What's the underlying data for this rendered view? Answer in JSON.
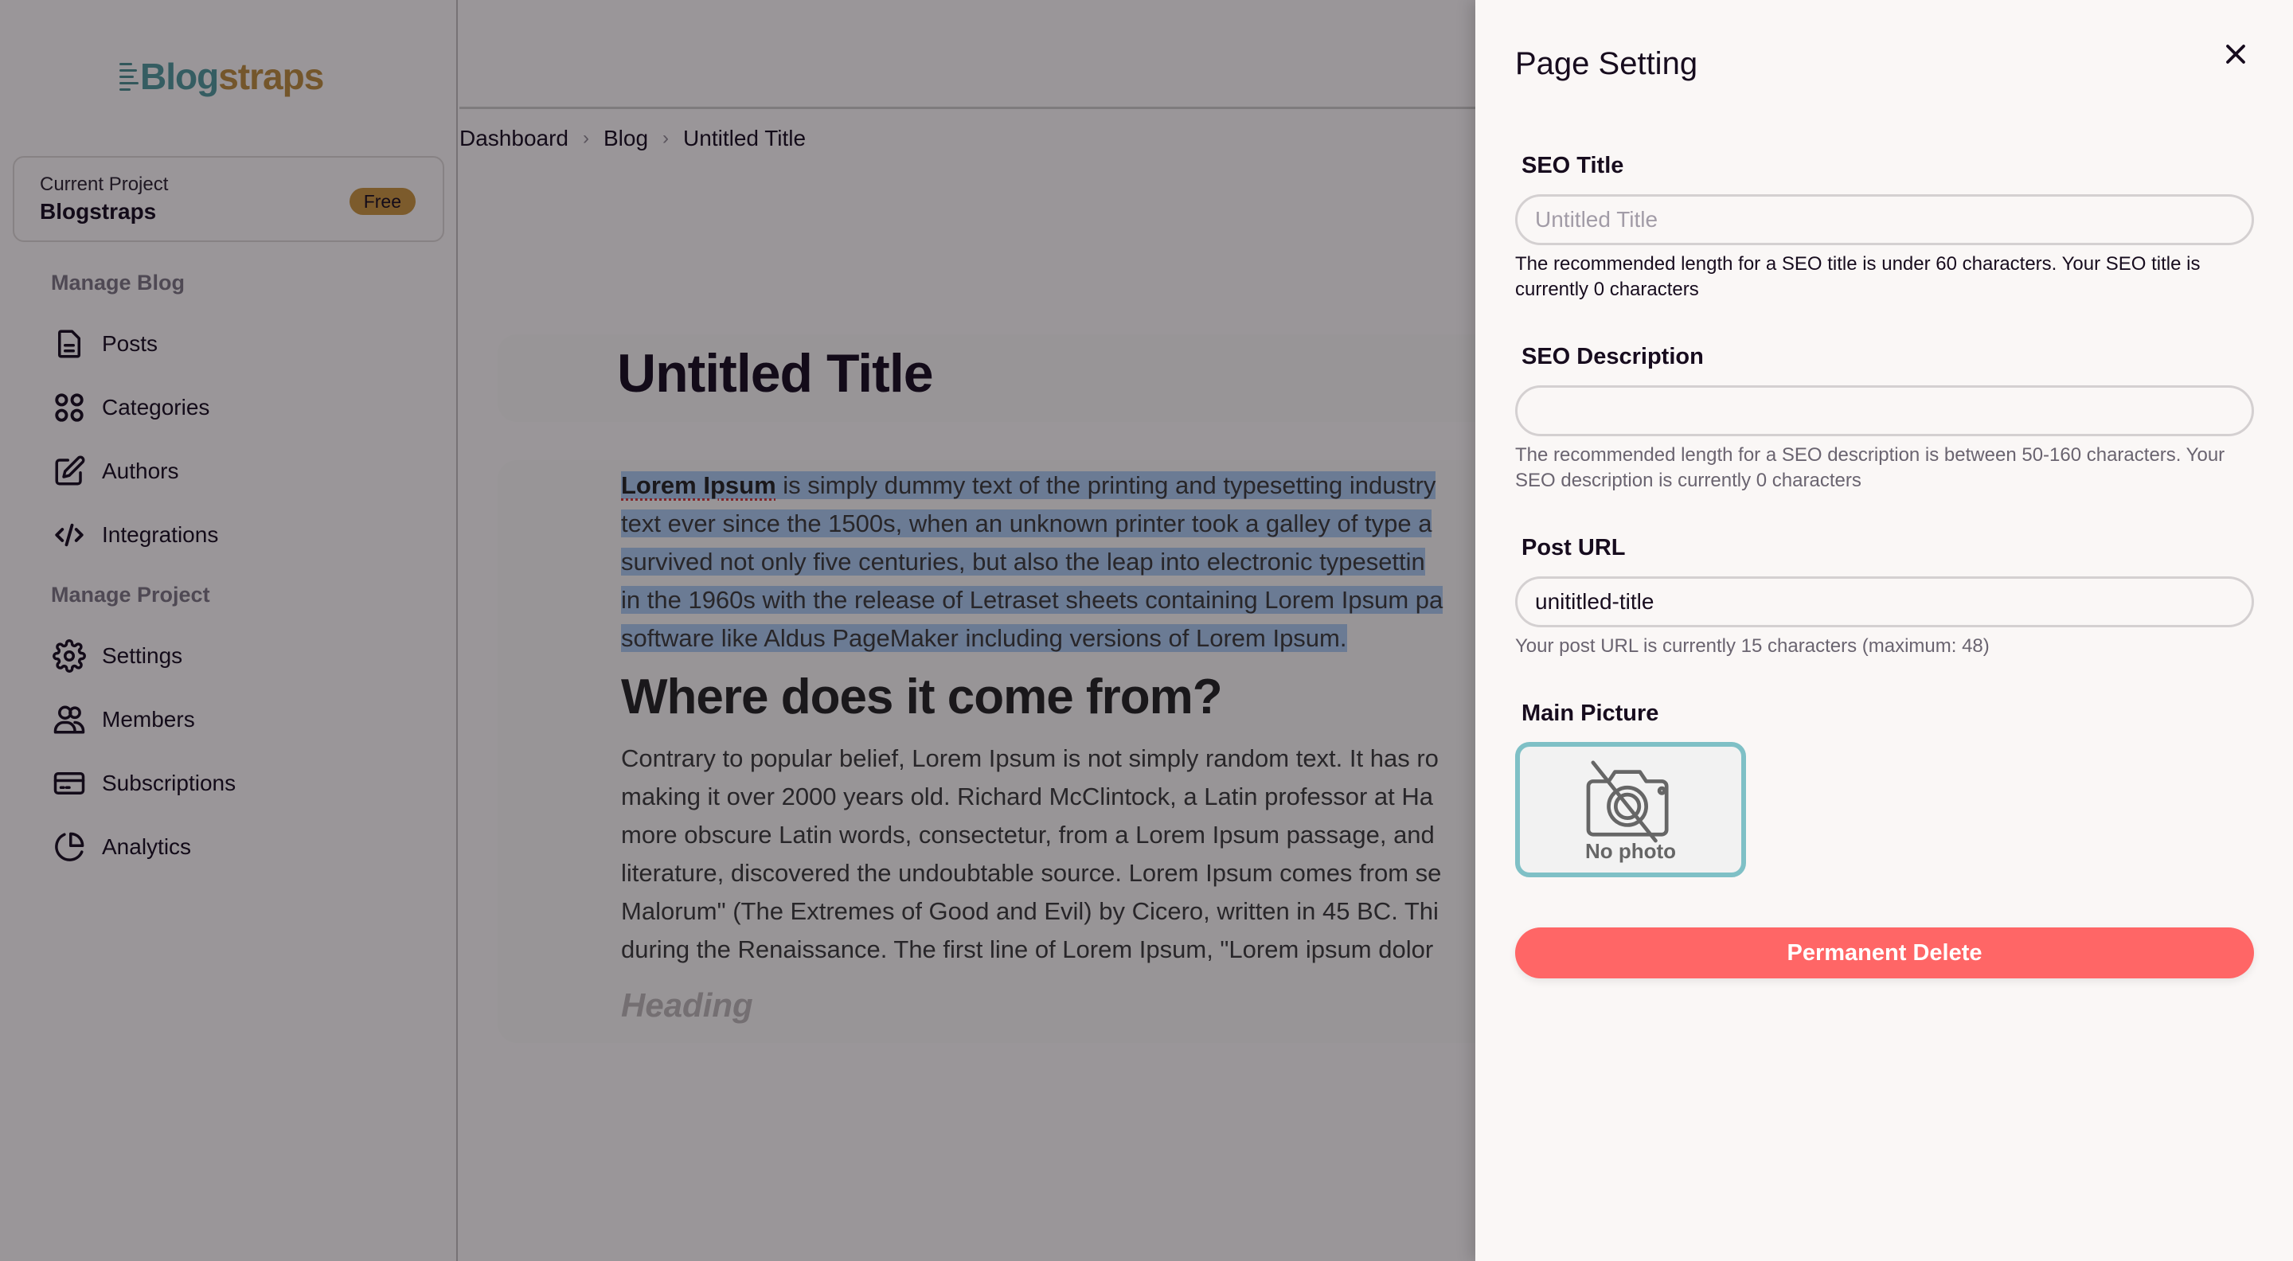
{
  "app": {
    "brand_part1": "Blog",
    "brand_part2": "straps",
    "colors": {
      "brand_teal": "#4f9598",
      "brand_gold": "#b7893c",
      "danger": "#ff6666",
      "photo_border": "#7fc0c6",
      "selection": "#a9c6ec"
    }
  },
  "sidebar": {
    "project": {
      "label": "Current Project",
      "name": "Blogstraps",
      "plan_badge": "Free"
    },
    "sections": [
      {
        "title": "Manage Blog",
        "items": [
          {
            "label": "Posts",
            "icon": "document-icon"
          },
          {
            "label": "Categories",
            "icon": "grid-icon"
          },
          {
            "label": "Authors",
            "icon": "edit-icon"
          },
          {
            "label": "Integrations",
            "icon": "code-icon"
          }
        ]
      },
      {
        "title": "Manage Project",
        "items": [
          {
            "label": "Settings",
            "icon": "gear-icon"
          },
          {
            "label": "Members",
            "icon": "users-icon"
          },
          {
            "label": "Subscriptions",
            "icon": "credit-card-icon"
          },
          {
            "label": "Analytics",
            "icon": "pie-chart-icon"
          }
        ]
      }
    ]
  },
  "breadcrumb": {
    "items": [
      "Dashboard",
      "Blog",
      "Untitled Title"
    ],
    "separator": "›"
  },
  "editor": {
    "title": "Untitled Title",
    "paragraph1": {
      "bold_lead": "Lorem Ipsum",
      "lines": [
        " is simply dummy text of the printing and typesetting industry",
        "text ever since the 1500s, when an unknown printer took a galley of type a",
        "survived not only five centuries, but also the leap into electronic typesettin",
        "in the 1960s with the release of Letraset sheets containing Lorem Ipsum pa",
        "software like Aldus PageMaker including versions of Lorem Ipsum."
      ]
    },
    "heading2": "Where does it come from?",
    "paragraph2_lines": [
      "Contrary to popular belief, Lorem Ipsum is not simply random text. It has ro",
      "making it over 2000 years old. Richard McClintock, a Latin professor at Ha",
      "more obscure Latin words, consectetur, from a Lorem Ipsum passage, and",
      "literature, discovered the undoubtable source. Lorem Ipsum comes from se",
      "Malorum\" (The Extremes of Good and Evil) by Cicero, written in 45 BC. Thi",
      "during the Renaissance. The first line of Lorem Ipsum, \"Lorem ipsum dolor"
    ],
    "heading_placeholder": "Heading"
  },
  "panel": {
    "title": "Page Setting",
    "close_icon": "close-icon",
    "seo_title": {
      "label": "SEO Title",
      "value": "",
      "placeholder": "Untitled Title",
      "help": "The recommended length for a SEO title is under 60 characters. Your SEO title is currently 0 characters"
    },
    "seo_description": {
      "label": "SEO Description",
      "value": "",
      "placeholder": "",
      "help": "The recommended length for a SEO description is between 50-160 characters. Your SEO description is currently 0 characters"
    },
    "post_url": {
      "label": "Post URL",
      "value": "unititled-title",
      "help": "Your post URL is currently 15 characters (maximum: 48)"
    },
    "main_picture": {
      "label": "Main Picture",
      "placeholder_text": "No photo"
    },
    "delete_button": "Permanent Delete"
  }
}
